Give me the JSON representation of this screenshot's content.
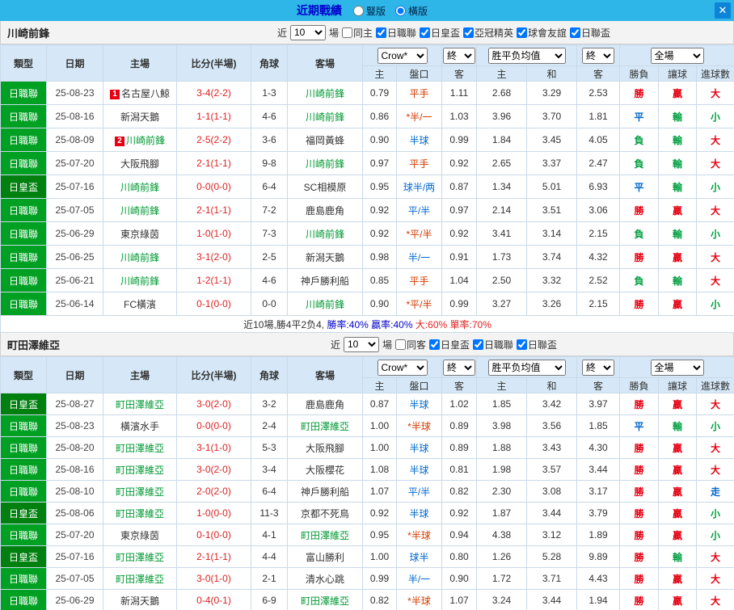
{
  "colors": {
    "result": {
      "勝": "#e60012",
      "平": "#0068cc",
      "負": "#00a040",
      "贏": "#e60012",
      "輸": "#00a040",
      "大": "#e60012",
      "小": "#00a040",
      "走": "#0068cc"
    },
    "handicap": {
      "red": "#d43a00",
      "blue": "#0068cc"
    },
    "league_bg": {
      "日職聯": "#00a023",
      "日皇盃": "#00800f"
    },
    "focus_team": "#009933",
    "other_team": "#333333",
    "score": "#dd2222"
  },
  "header": {
    "title": "近期戰績",
    "radios": [
      {
        "label": "豎版",
        "selected": false
      },
      {
        "label": "橫版",
        "selected": true
      }
    ],
    "close_label": "✕"
  },
  "table_header": {
    "type": "類型",
    "date": "日期",
    "home": "主場",
    "score": "比分(半場)",
    "corner": "角球",
    "away": "客場",
    "odds_source": "Crow*",
    "final": "終",
    "avg": "胜平负均值",
    "full": "全場",
    "sub": [
      "主",
      "盤口",
      "客",
      "主",
      "和",
      "客",
      "勝負",
      "讓球",
      "進球數"
    ]
  },
  "sections": [
    {
      "team": "川崎前鋒",
      "filter": {
        "near": "近",
        "count": "10",
        "unit": "場",
        "checkboxes": [
          {
            "label": "同主",
            "checked": false
          },
          {
            "label": "日職聯",
            "checked": true
          },
          {
            "label": "日皇盃",
            "checked": true
          },
          {
            "label": "亞冠精英",
            "checked": true
          },
          {
            "label": "球會友誼",
            "checked": true
          },
          {
            "label": "日聯盃",
            "checked": true
          }
        ]
      },
      "rows": [
        {
          "league": "日職聯",
          "date": "25-08-23",
          "home": "名古屋八鯨",
          "home_cards": "1",
          "score": "3-4(2-2)",
          "corner": "1-3",
          "away": "川崎前鋒",
          "odds": [
            "0.79",
            "平手",
            "1.11"
          ],
          "hcolor": "red",
          "avg": [
            "2.68",
            "3.29",
            "2.53"
          ],
          "result": [
            "勝",
            "贏",
            "大"
          ]
        },
        {
          "league": "日職聯",
          "date": "25-08-16",
          "home": "新潟天鵝",
          "score": "1-1(1-1)",
          "corner": "4-6",
          "away": "川崎前鋒",
          "odds": [
            "0.86",
            "*半/一",
            "1.03"
          ],
          "hcolor": "red",
          "avg": [
            "3.96",
            "3.70",
            "1.81"
          ],
          "result": [
            "平",
            "輸",
            "小"
          ]
        },
        {
          "league": "日職聯",
          "date": "25-08-09",
          "home": "川崎前鋒",
          "home_cards": "2",
          "score": "2-5(2-2)",
          "corner": "3-6",
          "away": "福岡黃蜂",
          "odds": [
            "0.90",
            "半球",
            "0.99"
          ],
          "hcolor": "blue",
          "avg": [
            "1.84",
            "3.45",
            "4.05"
          ],
          "result": [
            "負",
            "輸",
            "大"
          ]
        },
        {
          "league": "日職聯",
          "date": "25-07-20",
          "home": "大阪飛腳",
          "score": "2-1(1-1)",
          "corner": "9-8",
          "away": "川崎前鋒",
          "odds": [
            "0.97",
            "平手",
            "0.92"
          ],
          "hcolor": "red",
          "avg": [
            "2.65",
            "3.37",
            "2.47"
          ],
          "result": [
            "負",
            "輸",
            "大"
          ]
        },
        {
          "league": "日皇盃",
          "date": "25-07-16",
          "home": "川崎前鋒",
          "score": "0-0(0-0)",
          "corner": "6-4",
          "away": "SC相模原",
          "odds": [
            "0.95",
            "球半/两",
            "0.87"
          ],
          "hcolor": "blue",
          "avg": [
            "1.34",
            "5.01",
            "6.93"
          ],
          "result": [
            "平",
            "輸",
            "小"
          ]
        },
        {
          "league": "日職聯",
          "date": "25-07-05",
          "home": "川崎前鋒",
          "score": "2-1(1-1)",
          "corner": "7-2",
          "away": "鹿島鹿角",
          "odds": [
            "0.92",
            "平/半",
            "0.97"
          ],
          "hcolor": "blue",
          "avg": [
            "2.14",
            "3.51",
            "3.06"
          ],
          "result": [
            "勝",
            "贏",
            "大"
          ]
        },
        {
          "league": "日職聯",
          "date": "25-06-29",
          "home": "東京綠茵",
          "score": "1-0(1-0)",
          "corner": "7-3",
          "away": "川崎前鋒",
          "odds": [
            "0.92",
            "*平/半",
            "0.92"
          ],
          "hcolor": "red",
          "avg": [
            "3.41",
            "3.14",
            "2.15"
          ],
          "result": [
            "負",
            "輸",
            "小"
          ]
        },
        {
          "league": "日職聯",
          "date": "25-06-25",
          "home": "川崎前鋒",
          "score": "3-1(2-0)",
          "corner": "2-5",
          "away": "新潟天鵝",
          "odds": [
            "0.98",
            "半/一",
            "0.91"
          ],
          "hcolor": "blue",
          "avg": [
            "1.73",
            "3.74",
            "4.32"
          ],
          "result": [
            "勝",
            "贏",
            "大"
          ]
        },
        {
          "league": "日職聯",
          "date": "25-06-21",
          "home": "川崎前鋒",
          "score": "1-2(1-1)",
          "corner": "4-6",
          "away": "神戶勝利船",
          "odds": [
            "0.85",
            "平手",
            "1.04"
          ],
          "hcolor": "red",
          "avg": [
            "2.50",
            "3.32",
            "2.52"
          ],
          "result": [
            "負",
            "輸",
            "大"
          ]
        },
        {
          "league": "日職聯",
          "date": "25-06-14",
          "home": "FC橫濱",
          "score": "0-1(0-0)",
          "corner": "0-0",
          "away": "川崎前鋒",
          "odds": [
            "0.90",
            "*平/半",
            "0.99"
          ],
          "hcolor": "red",
          "avg": [
            "3.27",
            "3.26",
            "2.15"
          ],
          "result": [
            "勝",
            "贏",
            "小"
          ]
        }
      ],
      "summary": [
        {
          "text": "近10場,勝4平2负4, ",
          "color": "#333333"
        },
        {
          "text": "勝率:40% ",
          "color": "#0000cc"
        },
        {
          "text": "贏率:40% ",
          "color": "#0000cc"
        },
        {
          "text": "大:60% ",
          "color": "#dd2222"
        },
        {
          "text": "單率:70%",
          "color": "#dd2222"
        }
      ]
    },
    {
      "team": "町田澤維亞",
      "filter": {
        "near": "近",
        "count": "10",
        "unit": "場",
        "checkboxes": [
          {
            "label": "同客",
            "checked": false
          },
          {
            "label": "日皇盃",
            "checked": true
          },
          {
            "label": "日職聯",
            "checked": true
          },
          {
            "label": "日聯盃",
            "checked": true
          }
        ]
      },
      "rows": [
        {
          "league": "日皇盃",
          "date": "25-08-27",
          "home": "町田澤維亞",
          "score": "3-0(2-0)",
          "corner": "3-2",
          "away": "鹿島鹿角",
          "odds": [
            "0.87",
            "半球",
            "1.02"
          ],
          "hcolor": "blue",
          "avg": [
            "1.85",
            "3.42",
            "3.97"
          ],
          "result": [
            "勝",
            "贏",
            "大"
          ]
        },
        {
          "league": "日職聯",
          "date": "25-08-23",
          "home": "橫濱水手",
          "score": "0-0(0-0)",
          "corner": "2-4",
          "away": "町田澤維亞",
          "odds": [
            "1.00",
            "*半球",
            "0.89"
          ],
          "hcolor": "red",
          "avg": [
            "3.98",
            "3.56",
            "1.85"
          ],
          "result": [
            "平",
            "輸",
            "小"
          ]
        },
        {
          "league": "日職聯",
          "date": "25-08-20",
          "home": "町田澤維亞",
          "score": "3-1(1-0)",
          "corner": "5-3",
          "away": "大阪飛腳",
          "odds": [
            "1.00",
            "半球",
            "0.89"
          ],
          "hcolor": "blue",
          "avg": [
            "1.88",
            "3.43",
            "4.30"
          ],
          "result": [
            "勝",
            "贏",
            "大"
          ]
        },
        {
          "league": "日職聯",
          "date": "25-08-16",
          "home": "町田澤維亞",
          "score": "3-0(2-0)",
          "corner": "3-4",
          "away": "大阪櫻花",
          "odds": [
            "1.08",
            "半球",
            "0.81"
          ],
          "hcolor": "blue",
          "avg": [
            "1.98",
            "3.57",
            "3.44"
          ],
          "result": [
            "勝",
            "贏",
            "大"
          ]
        },
        {
          "league": "日職聯",
          "date": "25-08-10",
          "home": "町田澤維亞",
          "score": "2-0(2-0)",
          "corner": "6-4",
          "away": "神戶勝利船",
          "odds": [
            "1.07",
            "平/半",
            "0.82"
          ],
          "hcolor": "blue",
          "avg": [
            "2.30",
            "3.08",
            "3.17"
          ],
          "result": [
            "勝",
            "贏",
            "走"
          ]
        },
        {
          "league": "日皇盃",
          "date": "25-08-06",
          "home": "町田澤維亞",
          "score": "1-0(0-0)",
          "corner": "11-3",
          "away": "京都不死鳥",
          "odds": [
            "0.92",
            "半球",
            "0.92"
          ],
          "hcolor": "blue",
          "avg": [
            "1.87",
            "3.44",
            "3.79"
          ],
          "result": [
            "勝",
            "贏",
            "小"
          ]
        },
        {
          "league": "日職聯",
          "date": "25-07-20",
          "home": "東京綠茵",
          "score": "0-1(0-0)",
          "corner": "4-1",
          "away": "町田澤維亞",
          "odds": [
            "0.95",
            "*半球",
            "0.94"
          ],
          "hcolor": "red",
          "avg": [
            "4.38",
            "3.12",
            "1.89"
          ],
          "result": [
            "勝",
            "贏",
            "小"
          ]
        },
        {
          "league": "日皇盃",
          "date": "25-07-16",
          "home": "町田澤維亞",
          "score": "2-1(1-1)",
          "corner": "4-4",
          "away": "富山勝利",
          "odds": [
            "1.00",
            "球半",
            "0.80"
          ],
          "hcolor": "blue",
          "avg": [
            "1.26",
            "5.28",
            "9.89"
          ],
          "result": [
            "勝",
            "輸",
            "大"
          ]
        },
        {
          "league": "日職聯",
          "date": "25-07-05",
          "home": "町田澤維亞",
          "score": "3-0(1-0)",
          "corner": "2-1",
          "away": "清水心跳",
          "odds": [
            "0.99",
            "半/一",
            "0.90"
          ],
          "hcolor": "blue",
          "avg": [
            "1.72",
            "3.71",
            "4.43"
          ],
          "result": [
            "勝",
            "贏",
            "大"
          ]
        },
        {
          "league": "日職聯",
          "date": "25-06-29",
          "home": "新潟天鵝",
          "score": "0-4(0-1)",
          "corner": "6-9",
          "away": "町田澤維亞",
          "odds": [
            "0.82",
            "*半球",
            "1.07"
          ],
          "hcolor": "red",
          "avg": [
            "3.24",
            "3.44",
            "1.94"
          ],
          "result": [
            "勝",
            "贏",
            "大"
          ]
        }
      ]
    }
  ]
}
